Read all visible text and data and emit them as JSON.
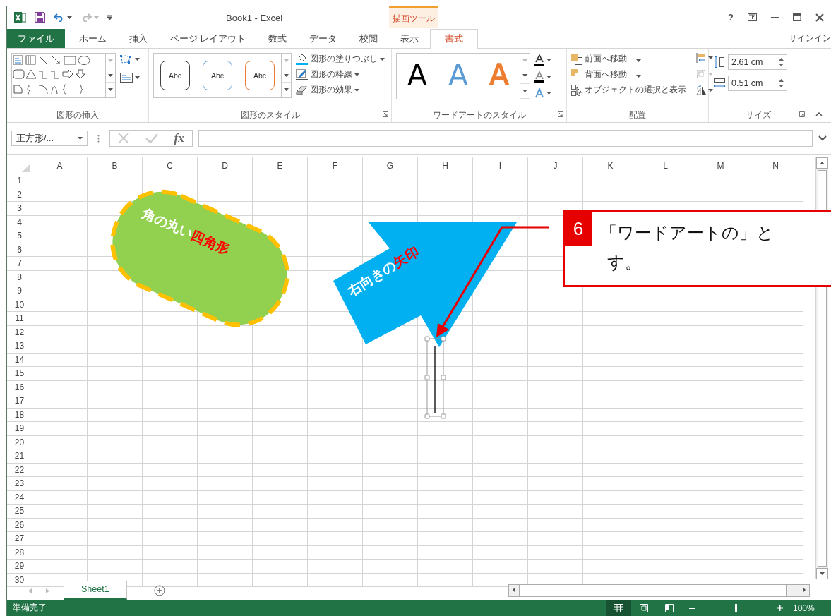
{
  "title_bar": {
    "title": "Book1 - Excel",
    "context_tab": "描画ツール",
    "help": "?"
  },
  "tabs": [
    {
      "label": "ファイル",
      "kind": "file",
      "selected": false
    },
    {
      "label": "ホーム",
      "kind": "normal",
      "selected": false
    },
    {
      "label": "挿入",
      "kind": "normal",
      "selected": false
    },
    {
      "label": "ページ レイアウト",
      "kind": "normal",
      "selected": false
    },
    {
      "label": "数式",
      "kind": "normal",
      "selected": false
    },
    {
      "label": "データ",
      "kind": "normal",
      "selected": false
    },
    {
      "label": "校閲",
      "kind": "normal",
      "selected": false
    },
    {
      "label": "表示",
      "kind": "normal",
      "selected": false
    },
    {
      "label": "書式",
      "kind": "context",
      "selected": true
    }
  ],
  "sign_in": "サインイン",
  "ribbon": {
    "shape_insert": {
      "label": "図形の挿入"
    },
    "shape_styles": {
      "label": "図形のスタイル",
      "presets": [
        {
          "text": "Abc",
          "color": "#404040"
        },
        {
          "text": "Abc",
          "color": "#5b9bd5"
        },
        {
          "text": "Abc",
          "color": "#ed7d31"
        }
      ],
      "commands": [
        "図形の塗りつぶし",
        "図形の枠線",
        "図形の効果"
      ]
    },
    "wordart": {
      "label": "ワードアートのスタイル",
      "presets": [
        {
          "text": "A",
          "color": "#000000"
        },
        {
          "text": "A",
          "color": "#5b9bd5"
        },
        {
          "text": "A",
          "color": "#ed7d31"
        }
      ]
    },
    "arrange": {
      "label": "配置",
      "commands": [
        "前面へ移動",
        "背面へ移動",
        "オブジェクトの選択と表示"
      ]
    },
    "size": {
      "label": "サイズ",
      "height": "2.61 cm",
      "width": "0.51 cm"
    }
  },
  "formula_bar": {
    "name_box": "正方形/...",
    "fx": "fx"
  },
  "sheet": {
    "columns": [
      "A",
      "B",
      "C",
      "D",
      "E",
      "F",
      "G",
      "H",
      "I",
      "J",
      "K",
      "L",
      "M",
      "N"
    ],
    "rows": [
      "1",
      "2",
      "3",
      "4",
      "5",
      "6",
      "7",
      "8",
      "9",
      "10",
      "11",
      "12",
      "13",
      "14",
      "15",
      "16",
      "17",
      "18",
      "19",
      "20",
      "21",
      "22",
      "23",
      "24",
      "25",
      "26",
      "27",
      "28",
      "29",
      "30"
    ]
  },
  "shapes": [
    {
      "kind": "rounded_rect",
      "parts": [
        {
          "text": "角の丸い",
          "color": "#ffffff"
        },
        {
          "text": "四角形",
          "color": "#ff0000"
        }
      ]
    },
    {
      "kind": "arrow",
      "parts": [
        {
          "text": "右向きの",
          "color": "#ffffff"
        },
        {
          "text": "矢印",
          "color": "#ff0000"
        }
      ]
    },
    {
      "kind": "text_box"
    }
  ],
  "callout": {
    "number": "6",
    "lines": [
      "「ワードアートの」と",
      "す。"
    ]
  },
  "sheet_tabs": [
    {
      "label": "Sheet1",
      "selected": true
    }
  ],
  "status_bar": {
    "text": "準備完了",
    "views": [
      {
        "kind": "normal",
        "selected": true
      },
      {
        "kind": "page_layout",
        "selected": false
      },
      {
        "kind": "page_break",
        "selected": false
      }
    ],
    "zoom": {
      "level": 0.5,
      "reading": "100%"
    }
  }
}
